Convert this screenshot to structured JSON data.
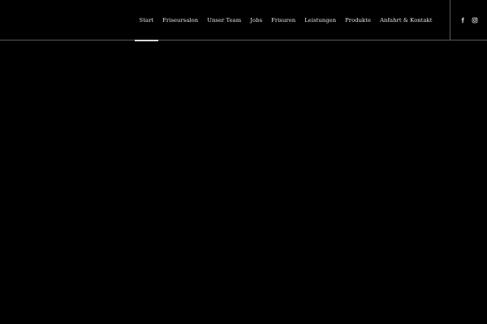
{
  "nav": {
    "items": [
      {
        "label": "Start",
        "active": true
      },
      {
        "label": "Friseursalon",
        "active": false
      },
      {
        "label": "Unser Team",
        "active": false
      },
      {
        "label": "Jobs",
        "active": false
      },
      {
        "label": "Frisuren",
        "active": false
      },
      {
        "label": "Leistungen",
        "active": false
      },
      {
        "label": "Produkte",
        "active": false
      },
      {
        "label": "Anfahrt & Kontakt",
        "active": false
      }
    ]
  },
  "social": {
    "icons": [
      "facebook-icon",
      "instagram-icon"
    ]
  },
  "colors": {
    "background": "#000000",
    "text": "#e8e8e8",
    "divider": "#5a5a5a",
    "active_indicator": "#d9d9d9"
  }
}
